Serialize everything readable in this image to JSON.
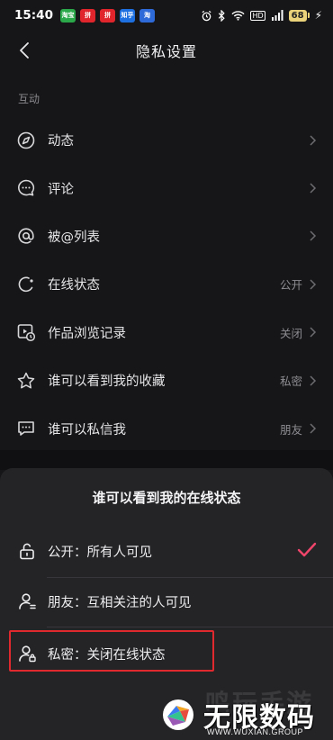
{
  "status_bar": {
    "time": "15:40",
    "app_icons": [
      {
        "text": "淘宝",
        "color": "#2aa84a"
      },
      {
        "text": "拼",
        "color": "#e0262c"
      },
      {
        "text": "拼",
        "color": "#e0262c"
      },
      {
        "text": "知乎",
        "color": "#1e6fe0"
      },
      {
        "text": "淘",
        "color": "#2f6bd8"
      }
    ],
    "battery": "68",
    "network": "HD"
  },
  "header": {
    "title": "隐私设置"
  },
  "section": {
    "title": "互动"
  },
  "list": [
    {
      "label": "动态",
      "value": "",
      "icon": "compass-icon"
    },
    {
      "label": "评论",
      "value": "",
      "icon": "comment-icon"
    },
    {
      "label": "被@列表",
      "value": "",
      "icon": "at-icon"
    },
    {
      "label": "在线状态",
      "value": "公开",
      "icon": "online-status-icon"
    },
    {
      "label": "作品浏览记录",
      "value": "关闭",
      "icon": "history-icon"
    },
    {
      "label": "谁可以看到我的收藏",
      "value": "私密",
      "icon": "star-icon"
    },
    {
      "label": "谁可以私信我",
      "value": "朋友",
      "icon": "message-icon"
    }
  ],
  "sheet": {
    "title": "谁可以看到我的在线状态",
    "options": [
      {
        "label": "公开：所有人可见",
        "selected": true,
        "icon": "unlock-icon"
      },
      {
        "label": "朋友：互相关注的人可见",
        "selected": false,
        "icon": "friends-icon"
      },
      {
        "label": "私密：关闭在线状态",
        "selected": false,
        "icon": "private-user-icon"
      }
    ]
  },
  "colors": {
    "check": "#f0456b",
    "highlight": "#e0282f",
    "background": "#161618",
    "sheet": "#242427"
  },
  "watermark": {
    "ghost_text": "鸣玩手游",
    "main_text": "无限数码",
    "sub_text": "WWW.WUXIAN.GROUP"
  }
}
